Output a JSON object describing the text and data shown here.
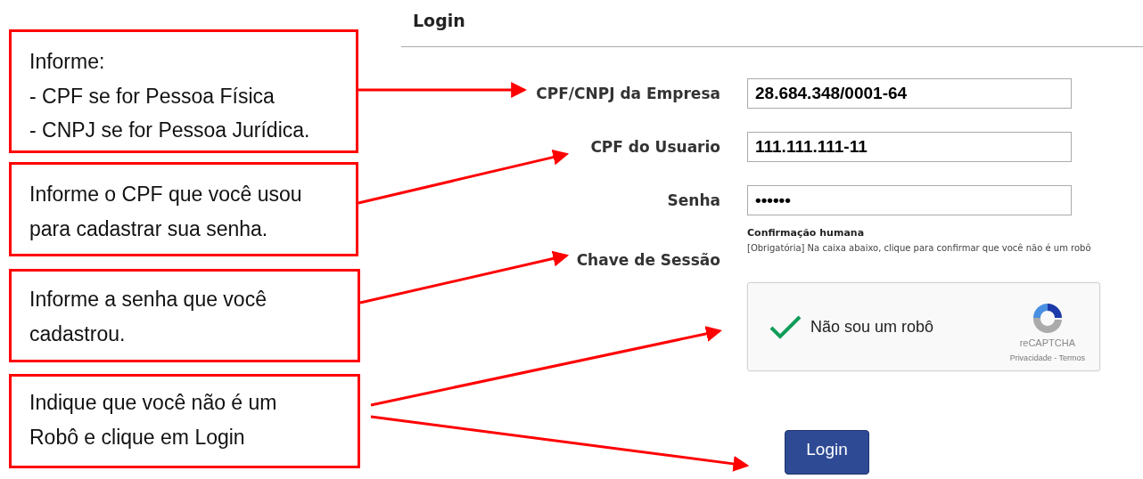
{
  "callouts": [
    {
      "lines": [
        "Informe:",
        "- CPF se for Pessoa Física",
        "- CNPJ se for Pessoa Jurídica."
      ]
    },
    {
      "lines": [
        "Informe o CPF que você usou",
        "para cadastrar sua senha."
      ]
    },
    {
      "lines": [
        "Informe a senha que você",
        "cadastrou."
      ]
    },
    {
      "lines": [
        "Indique que você não é um",
        "Robô e clique em Login"
      ]
    }
  ],
  "form": {
    "title": "Login",
    "fields": [
      {
        "label": "CPF/CNPJ da Empresa",
        "value": "28.684.348/0001-64"
      },
      {
        "label": "CPF do Usuario",
        "value": "111.111.111-11"
      },
      {
        "label": "Senha",
        "value": "••••••"
      }
    ],
    "session_key_label": "Chave de Sessão",
    "captcha": {
      "heading": "Confirmação humana",
      "instruction": "[Obrigatória] Na caixa abaixo, clique para confirmar que você não é um robô",
      "checked": true,
      "label": "Não sou um robô",
      "brand": "reCAPTCHA",
      "links": "Privacidade - Termos"
    },
    "submit": "Login"
  }
}
